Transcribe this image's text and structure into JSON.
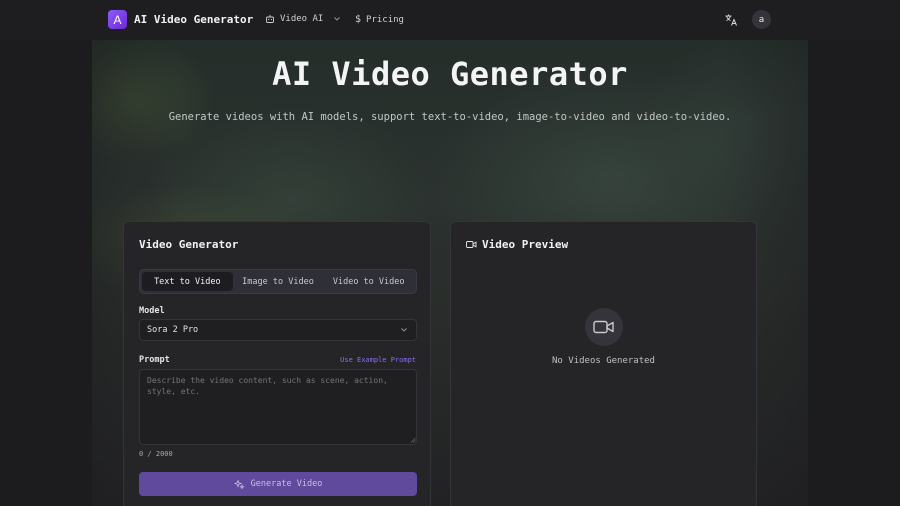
{
  "header": {
    "logo_letter": "A",
    "app_title": "AI Video Generator",
    "nav": [
      {
        "label": "Video AI",
        "icon": "robot-icon"
      },
      {
        "label": "Pricing",
        "icon": "dollar-icon"
      }
    ],
    "avatar_letter": "a"
  },
  "hero": {
    "title": "AI Video Generator",
    "subtitle": "Generate videos with AI models, support text-to-video, image-to-video and video-to-video."
  },
  "generator": {
    "title": "Video Generator",
    "tabs": [
      "Text to Video",
      "Image to Video",
      "Video to Video"
    ],
    "active_tab": 0,
    "model_label": "Model",
    "model_value": "Sora 2 Pro",
    "prompt_label": "Prompt",
    "example_link": "Use Example Prompt",
    "prompt_placeholder": "Describe the video content, such as scene, action, style, etc.",
    "counter": "0 / 2000",
    "generate_label": "Generate Video"
  },
  "preview": {
    "title": "Video Preview",
    "empty_text": "No Videos Generated"
  },
  "colors": {
    "accent": "#8b5cf6",
    "button": "#5f4a9c",
    "background": "#1c1c1f",
    "panel": "#252528"
  }
}
